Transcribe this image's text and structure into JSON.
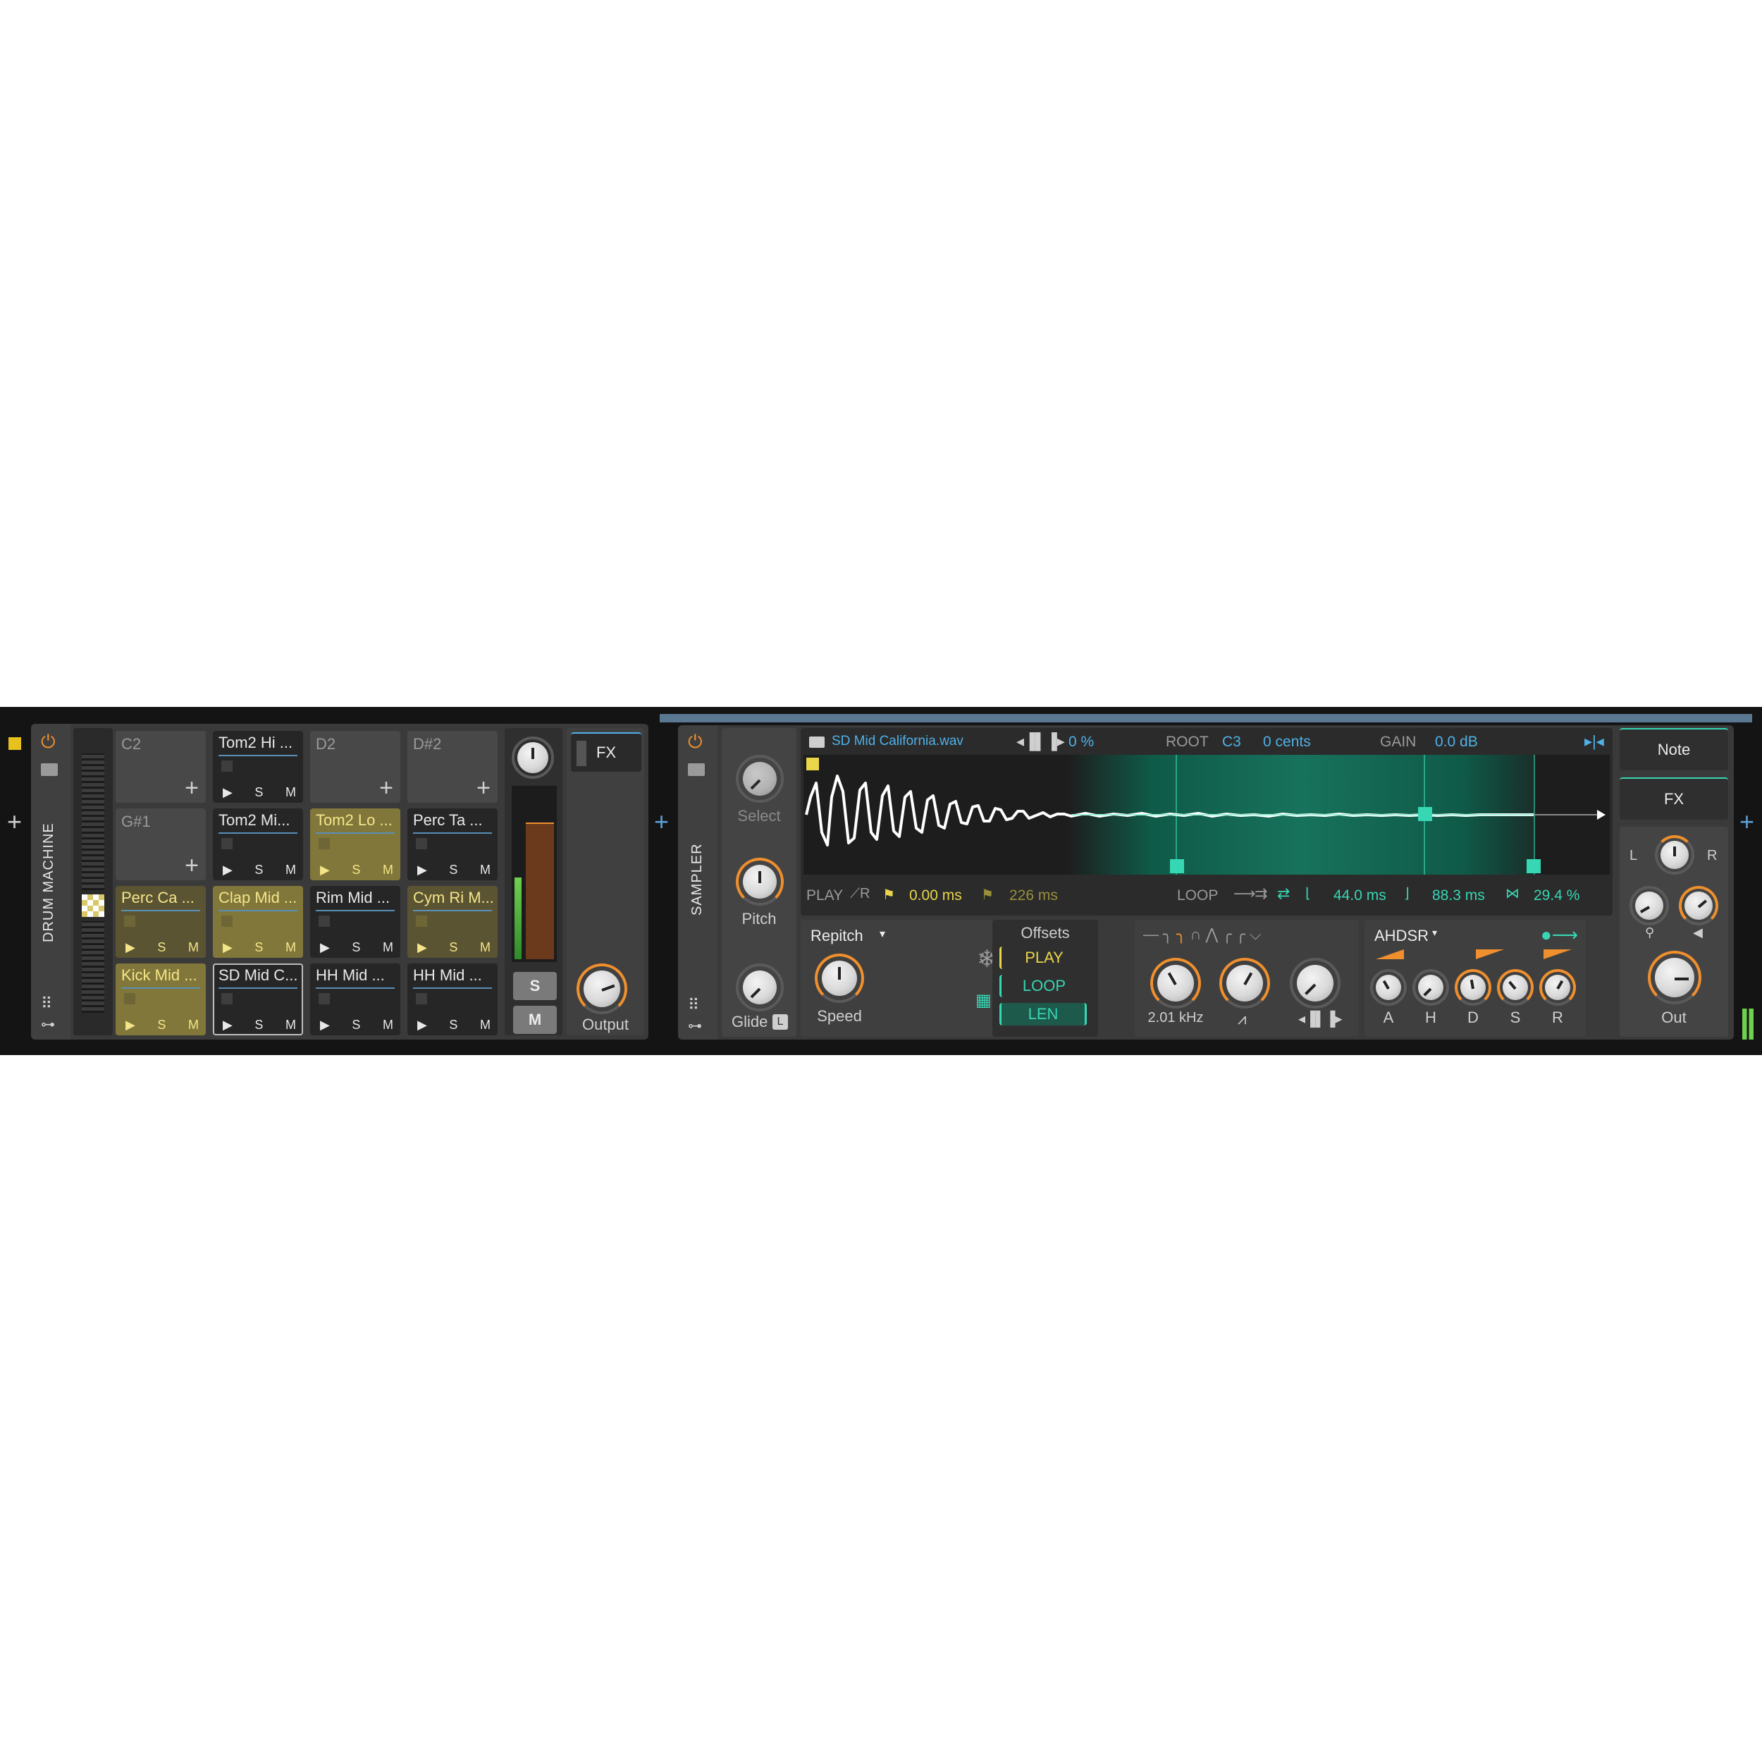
{
  "drum_machine": {
    "title": "DRUM MACHINE",
    "pads": [
      {
        "kind": "empty",
        "label": "C2"
      },
      {
        "kind": "sample",
        "label": "Tom2 Hi ..."
      },
      {
        "kind": "empty",
        "label": "D2"
      },
      {
        "kind": "empty",
        "label": "D#2"
      },
      {
        "kind": "empty",
        "label": "G#1"
      },
      {
        "kind": "sample",
        "label": "Tom2 Mi..."
      },
      {
        "kind": "sample",
        "label": "Tom2 Lo ...",
        "style": "gold"
      },
      {
        "kind": "sample",
        "label": "Perc Ta ..."
      },
      {
        "kind": "sample",
        "label": "Perc Ca ...",
        "style": "goldd"
      },
      {
        "kind": "sample",
        "label": "Clap Mid ...",
        "style": "gold"
      },
      {
        "kind": "sample",
        "label": "Rim Mid ..."
      },
      {
        "kind": "sample",
        "label": "Cym Ri M...",
        "style": "goldd"
      },
      {
        "kind": "sample",
        "label": "Kick Mid ...",
        "style": "gold"
      },
      {
        "kind": "sample",
        "label": "SD Mid C...",
        "style": "sel"
      },
      {
        "kind": "sample",
        "label": "HH Mid ..."
      },
      {
        "kind": "sample",
        "label": "HH Mid ..."
      }
    ],
    "pad_solo": "S",
    "pad_mute": "M",
    "solo_button": "S",
    "mute_button": "M",
    "fx_button": "FX",
    "output_label": "Output"
  },
  "sampler": {
    "title": "SAMPLER",
    "select_label": "Select",
    "pitch_label": "Pitch",
    "glide_label": "Glide",
    "glide_badge": "L",
    "file_name": "SD Mid California.wav",
    "percent": "0 %",
    "root_label": "ROOT",
    "root_note": "C3",
    "cents": "0 cents",
    "gain_label": "GAIN",
    "gain_value": "0.0 dB",
    "play_label": "PLAY",
    "play_start": "0.00 ms",
    "play_end": "226 ms",
    "loop_label": "LOOP",
    "loop_start": "44.0 ms",
    "loop_length": "88.3 ms",
    "loop_xfade": "29.4 %",
    "mode": "Repitch",
    "speed_label": "Speed",
    "offsets_label": "Offsets",
    "offsets": [
      "PLAY",
      "LOOP",
      "LEN"
    ],
    "filter_freq": "2.01 kHz",
    "env_name": "AHDSR",
    "env_labels": [
      "A",
      "H",
      "D",
      "S",
      "R"
    ],
    "note_button": "Note",
    "fx_button": "FX",
    "pan_l": "L",
    "pan_r": "R",
    "out_label": "Out"
  },
  "colors": {
    "accent_orange": "#ef8f2e",
    "accent_teal": "#37d7b4",
    "accent_blue": "#4fb1e8",
    "accent_yellow": "#e9d64a"
  }
}
